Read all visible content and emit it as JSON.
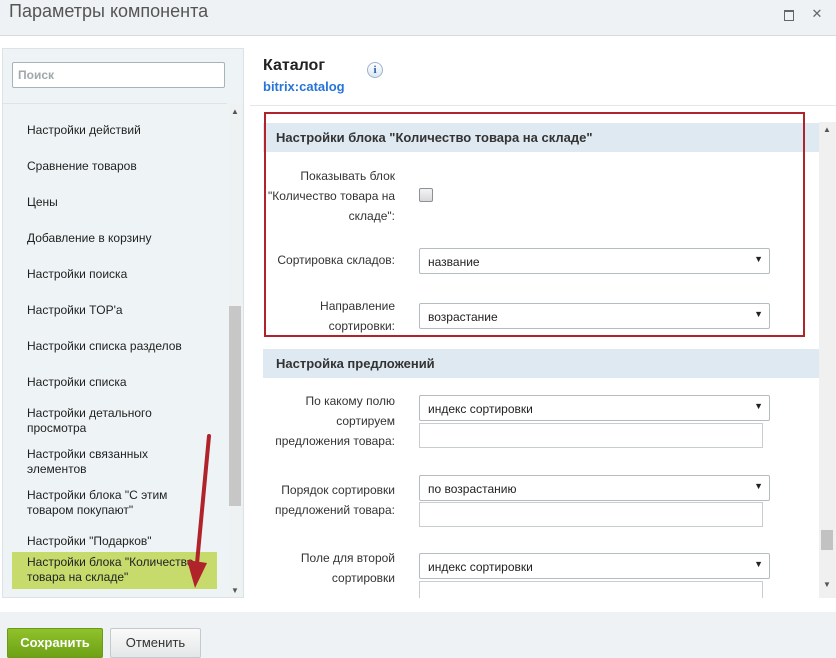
{
  "window": {
    "title": "Параметры компонента",
    "maximize_icon": "maximize-icon",
    "close_icon": "✕"
  },
  "sidebar": {
    "search_placeholder": "Поиск",
    "items": [
      {
        "label": "Настройки действий"
      },
      {
        "label": "Сравнение товаров"
      },
      {
        "label": "Цены"
      },
      {
        "label": "Добавление в корзину"
      },
      {
        "label": "Настройки поиска"
      },
      {
        "label": "Настройки TOP'a"
      },
      {
        "label": "Настройки списка разделов"
      },
      {
        "label": "Настройки списка"
      },
      {
        "label": "Настройки детального просмотра"
      },
      {
        "label": "Настройки связанных элементов"
      },
      {
        "label": "Настройки блока \"С этим товаром покупают\""
      },
      {
        "label": "Настройки \"Подарков\""
      },
      {
        "label": "Настройки блока \"Количество товара на складе\"",
        "active": true
      }
    ]
  },
  "main": {
    "title": "Каталог",
    "subtitle": "bitrix:catalog",
    "info_icon": "i",
    "sections": [
      {
        "heading": "Настройки блока \"Количество товара на складе\"",
        "fields": [
          {
            "label": "Показывать блок \"Количество товара на складе\":",
            "type": "checkbox",
            "checked": false
          },
          {
            "label": "Сортировка складов:",
            "type": "select",
            "value": "название"
          },
          {
            "label": "Направление сортировки:",
            "type": "select",
            "value": "возрастание"
          }
        ]
      },
      {
        "heading": "Настройка предложений",
        "fields": [
          {
            "label": "По какому полю сортируем предложения товара:",
            "type": "select",
            "value": "индекс сортировки"
          },
          {
            "label": "Порядок сортировки предложений товара:",
            "type": "select",
            "value": "по возрастанию"
          },
          {
            "label": "Поле для второй сортировки",
            "type": "select",
            "value": "индекс сортировки"
          }
        ]
      }
    ]
  },
  "footer": {
    "save_label": "Сохранить",
    "cancel_label": "Отменить"
  },
  "colors": {
    "highlight": "#b0232a",
    "active_item": "#c6db6c",
    "save_button": "#7ab020",
    "link": "#2675d7"
  }
}
